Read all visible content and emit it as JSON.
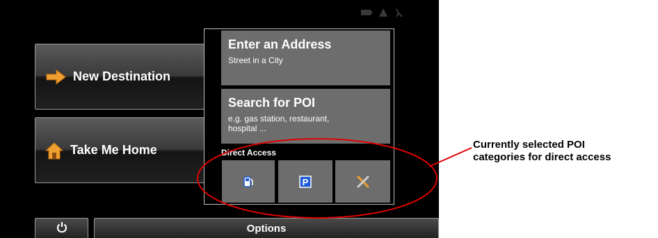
{
  "main_menu": {
    "new_destination_label": "New Destination",
    "take_me_home_label": "Take Me Home",
    "enter_address": {
      "title": "Enter an Address",
      "subtitle": "Street in a City"
    },
    "search_poi": {
      "title": "Search for POI",
      "subtitle_line1": "e.g. gas station, restaurant,",
      "subtitle_line2": "hospital ..."
    },
    "direct_access_label": "Direct Access",
    "direct_access_items": [
      {
        "icon": "fuel-pump-icon"
      },
      {
        "icon": "parking-icon"
      },
      {
        "icon": "fork-knife-icon"
      }
    ],
    "options_label": "Options"
  },
  "status_bar": {
    "icons": [
      "battery-icon",
      "gps-signal-icon",
      "satellite-icon"
    ]
  },
  "annotation": {
    "line1": "Currently selected POI",
    "line2": "categories for direct access",
    "color": "#e00000"
  },
  "colors": {
    "screen_bg": "#000000",
    "tile_bg": "#6d6d6d",
    "arrow_orange": "#f0a030",
    "parking_blue": "#1e5bd8"
  }
}
